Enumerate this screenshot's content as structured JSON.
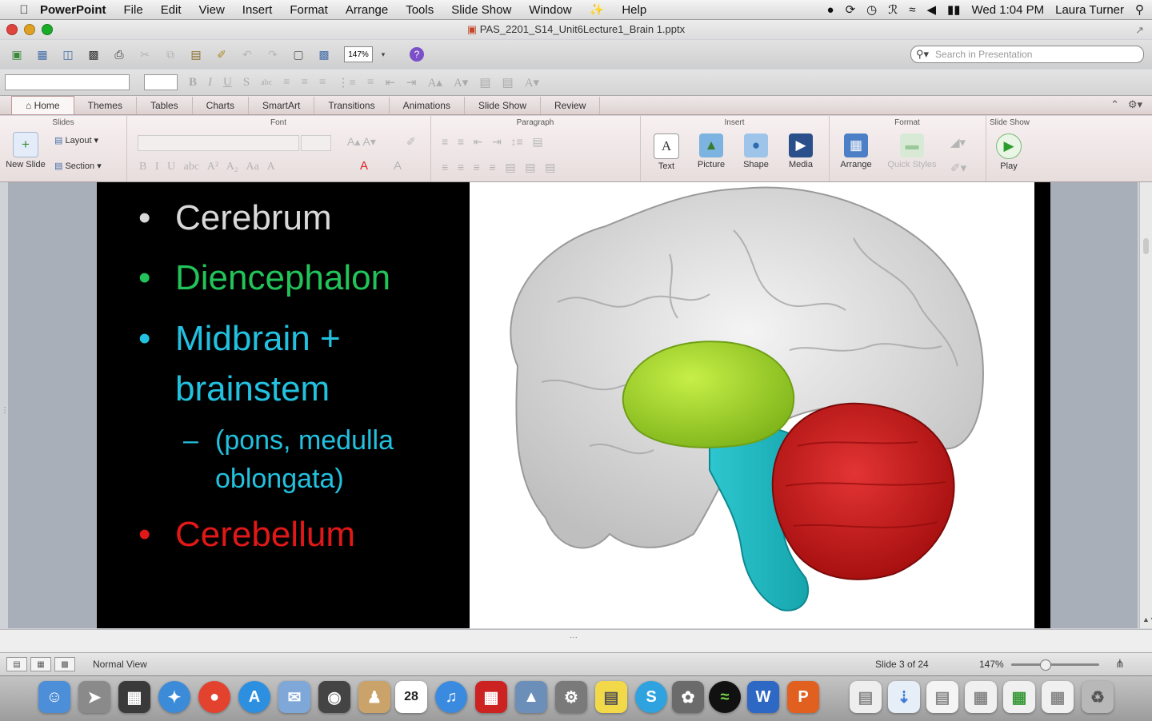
{
  "menubar": {
    "app_name": "PowerPoint",
    "items": [
      "File",
      "Edit",
      "View",
      "Insert",
      "Format",
      "Arrange",
      "Tools",
      "Slide Show",
      "Window",
      "Help"
    ],
    "clock": "Wed 1:04 PM",
    "user": "Laura Turner"
  },
  "window": {
    "title": "PAS_2201_S14_Unit6Lecture1_Brain 1.pptx"
  },
  "toolbar": {
    "zoom_value": "147%",
    "search_placeholder": "Search in Presentation"
  },
  "ribbon": {
    "tabs": [
      "Home",
      "Themes",
      "Tables",
      "Charts",
      "SmartArt",
      "Transitions",
      "Animations",
      "Slide Show",
      "Review"
    ],
    "active_tab": "Home",
    "groups": {
      "slides": "Slides",
      "font": "Font",
      "paragraph": "Paragraph",
      "insert": "Insert",
      "format": "Format",
      "slide_show": "Slide Show"
    },
    "buttons": {
      "new_slide": "New Slide",
      "layout": "Layout",
      "section": "Section",
      "text": "Text",
      "picture": "Picture",
      "shape": "Shape",
      "media": "Media",
      "arrange": "Arrange",
      "quick_styles": "Quick Styles",
      "play": "Play"
    }
  },
  "slide": {
    "bullets": [
      {
        "text": "Cerebrum",
        "color": "#d9d9d9"
      },
      {
        "text": "Diencephalon",
        "color": "#22c45a"
      },
      {
        "text": "Midbrain +",
        "color": "#22c1e0"
      },
      {
        "text": "brainstem",
        "color": "#22c1e0"
      },
      {
        "text": "(pons, medulla",
        "color": "#22c1e0"
      },
      {
        "text": "oblongata)",
        "color": "#22c1e0"
      },
      {
        "text": "Cerebellum",
        "color": "#e01818"
      }
    ],
    "bullet_glyph": "•",
    "sub_glyph": "–"
  },
  "status": {
    "view_name": "Normal View",
    "slide_position": "Slide 3 of 24",
    "zoom": "147%"
  },
  "dock": {
    "calendar_day": "28"
  }
}
